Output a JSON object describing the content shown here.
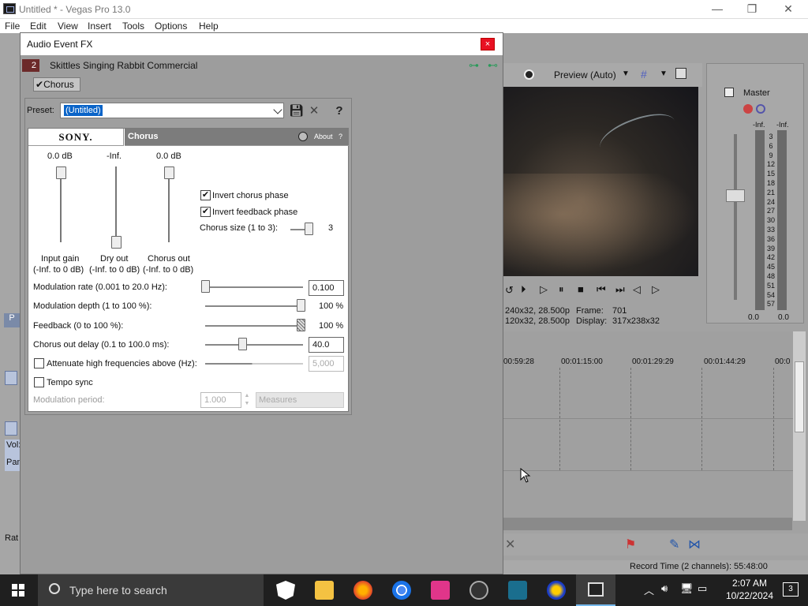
{
  "window": {
    "title": "Untitled * - Vegas Pro 13.0",
    "minimize": "—",
    "maximize": "❐",
    "close": "✕"
  },
  "menu": [
    "File",
    "Edit",
    "View",
    "Insert",
    "Tools",
    "Options",
    "Help"
  ],
  "dialog": {
    "title": "Audio Event FX",
    "close": "×",
    "chain_number": "2",
    "event_name": "Skittles Singing Rabbit Commercial",
    "chain_tab": "Chorus",
    "preset_label": "Preset:",
    "preset_value": "(Untitled)",
    "plugin": {
      "brand": "SONY.",
      "name": "Chorus",
      "about": "About",
      "help": "?",
      "sliders": [
        {
          "value": "0.0 dB",
          "label": "Input gain",
          "range": "(-Inf. to 0 dB)",
          "level": 1.0
        },
        {
          "value": "-Inf.",
          "label": "Dry out",
          "range": "(-Inf. to 0 dB)",
          "level": 0.0
        },
        {
          "value": "0.0 dB",
          "label": "Chorus out",
          "range": "(-Inf. to 0 dB)",
          "level": 1.0
        }
      ],
      "invert_chorus_phase": {
        "label": "Invert chorus phase",
        "checked": true
      },
      "invert_feedback_phase": {
        "label": "Invert feedback phase",
        "checked": true
      },
      "chorus_size": {
        "label": "Chorus size (1 to 3):",
        "value": "3"
      },
      "modulation_rate": {
        "label": "Modulation rate (0.001 to 20.0 Hz):",
        "value": "0.100"
      },
      "modulation_depth": {
        "label": "Modulation depth (1 to 100 %):",
        "value": "100 %"
      },
      "feedback": {
        "label": "Feedback (0 to 100 %):",
        "value": "100 %"
      },
      "chorus_out_delay": {
        "label": "Chorus out delay (0.1 to 100.0 ms):",
        "value": "40.0"
      },
      "attenuate": {
        "label": "Attenuate high frequencies above (Hz):",
        "value": "5,000",
        "checked": false
      },
      "tempo_sync": {
        "label": "Tempo sync",
        "checked": false
      },
      "modulation_period": {
        "label": "Modulation period:",
        "value": "1.000",
        "unit": "Measures"
      }
    }
  },
  "preview": {
    "mode": "Preview (Auto)",
    "info_line1_a": "240x32, 28.500p",
    "info_frame_label": "Frame:",
    "info_frame": "701",
    "info_line2_a": "120x32, 28.500p",
    "info_display_label": "Display:",
    "info_display": "317x238x32"
  },
  "mixer": {
    "title": "Master",
    "left_label": "-Inf.",
    "right_label": "-Inf.",
    "scale": [
      "3",
      "6",
      "9",
      "12",
      "15",
      "18",
      "21",
      "24",
      "27",
      "30",
      "33",
      "36",
      "39",
      "42",
      "45",
      "48",
      "51",
      "54",
      "57"
    ],
    "bottom_left": "0.0",
    "bottom_right": "0.0"
  },
  "timeline": {
    "ruler": [
      "00:59:28",
      "00:01:15:00",
      "00:01:29:29",
      "00:01:44:29",
      "00:0"
    ]
  },
  "left_panel": {
    "vol": "Vol:",
    "pan": "Pan",
    "rate": "Rat",
    "p": "P"
  },
  "status": {
    "record_time": "Record Time (2 channels): 55:48:00"
  },
  "taskbar": {
    "search_placeholder": "Type here to search",
    "time": "2:07 AM",
    "date": "10/22/2024",
    "notifications": "3"
  }
}
